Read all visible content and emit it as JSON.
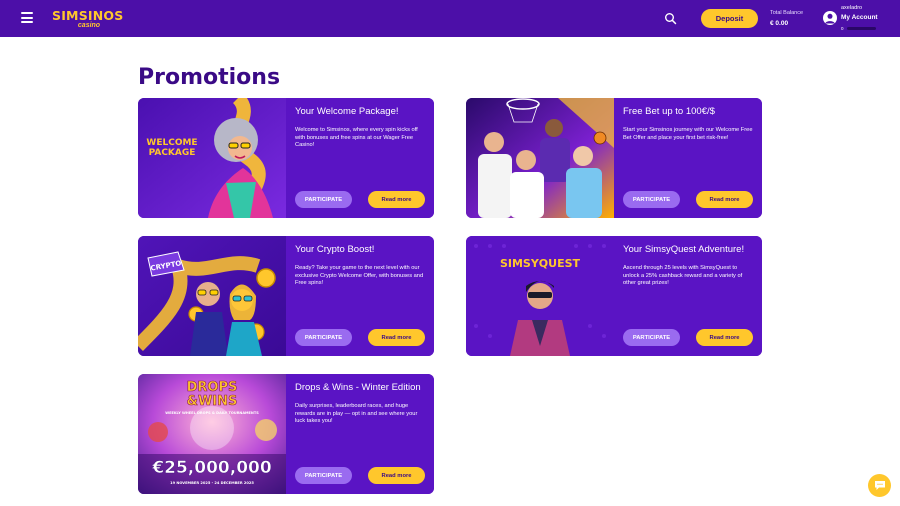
{
  "header": {
    "logo_main": "SIMSINOS",
    "logo_sub": "casino",
    "deposit_label": "Deposit",
    "balance_label": "Total Balance",
    "balance_value": "€ 0.00",
    "username": "axeladro",
    "account_label": "My Account",
    "level": "0",
    "level_progress": 0
  },
  "page": {
    "title": "Promotions"
  },
  "cards": [
    {
      "title": "Your Welcome Package!",
      "description": "Welcome to Simsinos, where every spin kicks off with bonuses and free spins at our Wager Free Casino!",
      "image_text": "WELCOME\nPACKAGE",
      "participate": "PARTICIPATE",
      "read_more": "Read more"
    },
    {
      "title": "Free Bet up to 100€/$",
      "description": "Start your Simsinos journey with our Welcome Free Bet Offer and place your first bet risk-free!",
      "participate": "PARTICIPATE",
      "read_more": "Read more"
    },
    {
      "title": "Your Crypto Boost!",
      "description": "Ready? Take your game to the next level with our exclusive Crypto Welcome Offer, with bonuses and Free spins!",
      "image_text": "CRYPTO",
      "participate": "PARTICIPATE",
      "read_more": "Read more"
    },
    {
      "title": "Your SimsyQuest Adventure!",
      "description": "Ascend through 25 levels with SimsyQuest to unlock a 25% cashback reward and a variety of other great prizes!",
      "image_text": "SIMSYQUEST",
      "participate": "PARTICIPATE",
      "read_more": "Read more"
    },
    {
      "title": "Drops & Wins - Winter Edition",
      "description": "Daily surprises, leaderboard races, and huge rewards are in play — opt in and see where your luck takes you!",
      "image_title_1": "DROPS",
      "image_title_2": "&WINS",
      "image_subtitle": "WEEKLY WHEEL DROPS & DAILY TOURNAMENTS",
      "image_amount": "€25,000,000",
      "image_dates": "19 NOVEMBER 2025 - 24 DECEMBER 2025",
      "participate": "PARTICIPATE",
      "read_more": "Read more"
    }
  ],
  "colors": {
    "header_bg": "#4c0fa8",
    "accent_yellow": "#ffc72c",
    "card_purple": "#5a14c4",
    "participate_purple": "#9a6bf0",
    "title_purple": "#3a0a86"
  },
  "icons": {
    "menu": "hamburger-menu-icon",
    "search": "search-icon",
    "account": "user-avatar-icon",
    "chat": "chat-bubble-icon"
  }
}
